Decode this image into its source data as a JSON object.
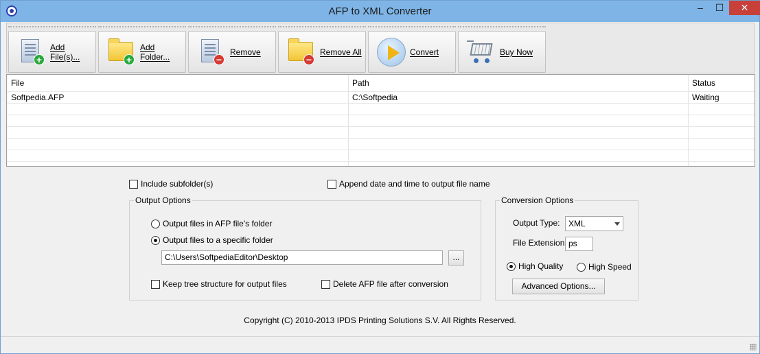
{
  "window": {
    "title": "AFP to XML Converter",
    "minimize_glyph": "–",
    "maximize_glyph": "☐",
    "close_glyph": "✕"
  },
  "toolbar": {
    "buttons": [
      {
        "label": "Add File(s)...",
        "icon": "add-file-icon"
      },
      {
        "label": "Add Folder...",
        "icon": "add-folder-icon"
      },
      {
        "label": "Remove",
        "icon": "remove-file-icon"
      },
      {
        "label": "Remove All",
        "icon": "remove-all-icon"
      },
      {
        "label": "Convert",
        "icon": "convert-play-icon"
      },
      {
        "label": "Buy Now",
        "icon": "shopping-cart-icon"
      }
    ]
  },
  "filelist": {
    "columns": [
      "File",
      "Path",
      "Status"
    ],
    "rows": [
      {
        "file": "Softpedia.AFP",
        "path": "C:\\Softpedia",
        "status": "Waiting"
      }
    ]
  },
  "options": {
    "include_subfolders": {
      "label": "Include subfolder(s)",
      "checked": false
    },
    "append_datetime": {
      "label": "Append date and time to output file name",
      "checked": false
    },
    "output_group_title": "Output Options",
    "output_in_afp_folder": {
      "label": "Output files in AFP file's folder",
      "selected": false
    },
    "output_specific_folder": {
      "label": "Output files to a specific folder",
      "selected": true
    },
    "output_path": "C:\\Users\\SoftpediaEditor\\Desktop",
    "browse_label": "...",
    "keep_tree": {
      "label": "Keep tree structure for output files",
      "checked": false
    },
    "delete_afp": {
      "label": "Delete AFP file after conversion",
      "checked": false
    }
  },
  "conversion": {
    "group_title": "Conversion Options",
    "output_type_label": "Output Type:",
    "output_type_value": "XML",
    "file_extension_label": "File Extension:",
    "file_extension_value": "ps",
    "high_quality": {
      "label": "High Quality",
      "selected": true
    },
    "high_speed": {
      "label": "High Speed",
      "selected": false
    },
    "advanced_label": "Advanced Options..."
  },
  "footer": {
    "copyright": "Copyright (C) 2010-2013 IPDS Printing Solutions S.V.  All Rights Reserved."
  }
}
